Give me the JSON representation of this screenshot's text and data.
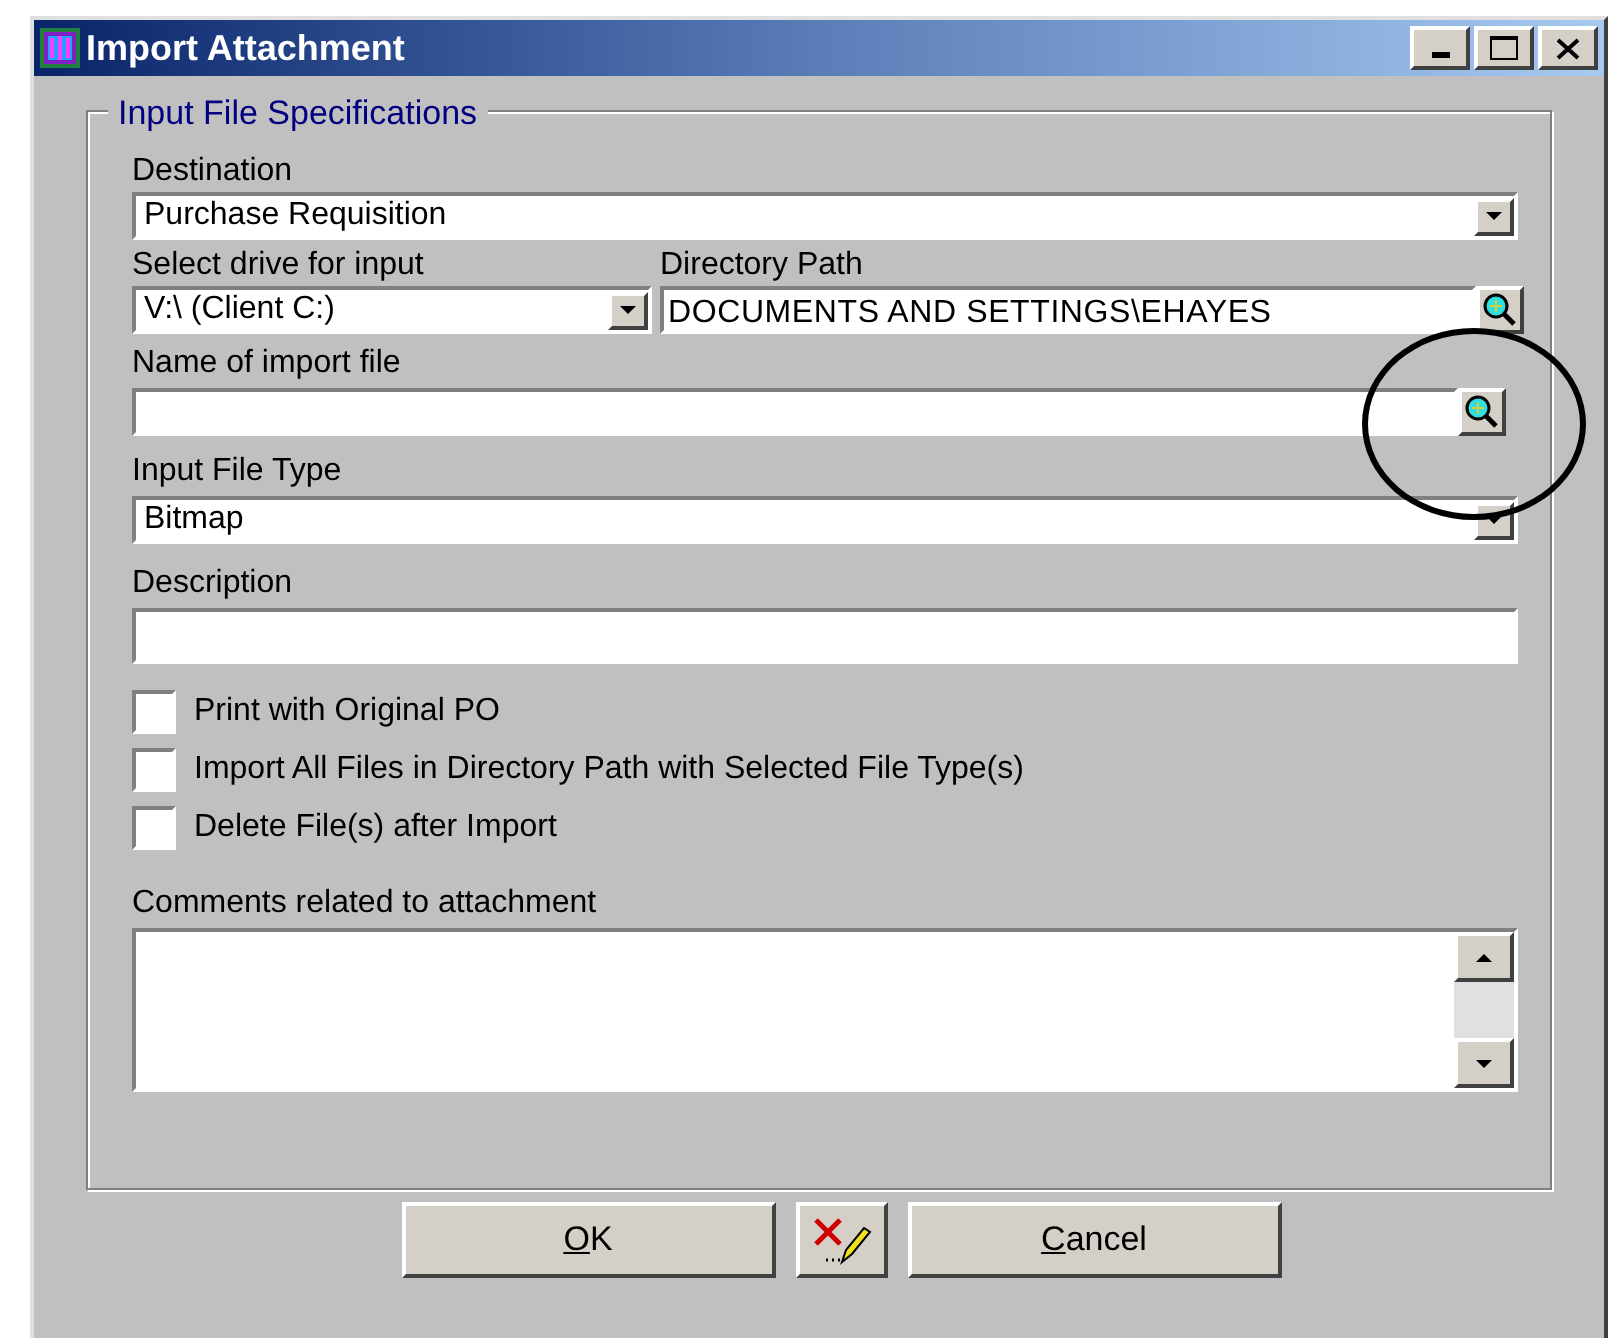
{
  "window": {
    "title": "Import Attachment"
  },
  "group": {
    "title": "Input File Specifications"
  },
  "destination": {
    "label": "Destination",
    "value": "Purchase Requisition"
  },
  "drive": {
    "label": "Select drive for input",
    "value": "V:\\ (Client C:)"
  },
  "directory": {
    "label": "Directory Path",
    "value": "DOCUMENTS AND SETTINGS\\EHAYES"
  },
  "import_file": {
    "label": "Name of import file",
    "highlighted": true
  },
  "file_type": {
    "label": "Input File Type",
    "value": "Bitmap"
  },
  "description": {
    "label": "Description"
  },
  "options": [
    {
      "label": "Print with Original PO",
      "checked": false
    },
    {
      "label": "Import All Files in Directory Path with Selected File Type(s)",
      "checked": false
    },
    {
      "label": "Delete File(s) after Import",
      "checked": false
    }
  ],
  "comments": {
    "label": "Comments related to attachment"
  },
  "buttons": [
    {
      "kind": "text",
      "label": "OK"
    },
    {
      "kind": "icon"
    },
    {
      "kind": "text",
      "label": "Cancel"
    }
  ]
}
